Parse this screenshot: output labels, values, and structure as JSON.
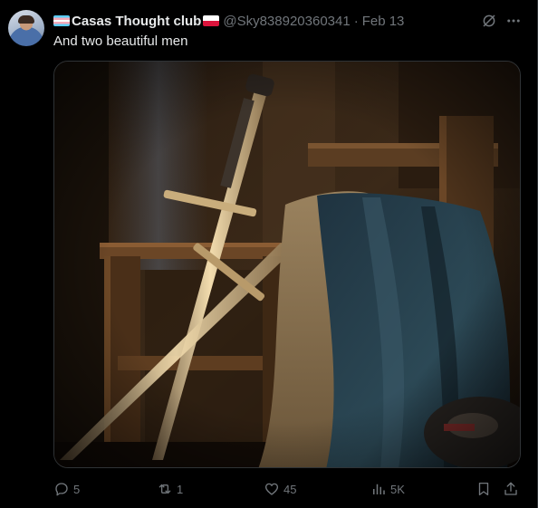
{
  "post": {
    "display_name": "Casas Thought club",
    "handle": "@Sky838920360341",
    "separator": "·",
    "date": "Feb 13",
    "text": "And two beautiful men"
  },
  "icons": {
    "left_flag": "transgender-flag-icon",
    "right_flag": "poland-flag-icon",
    "grok": "grok-icon",
    "more": "more-icon"
  },
  "media": {
    "subject": "two-swords-and-cloak-on-chair"
  },
  "actions": {
    "replies": "5",
    "reposts": "1",
    "likes": "45",
    "views": "5K"
  },
  "colors": {
    "background": "#000000",
    "text": "#e7e9ea",
    "secondary": "#71767b",
    "border": "#2f3336"
  }
}
